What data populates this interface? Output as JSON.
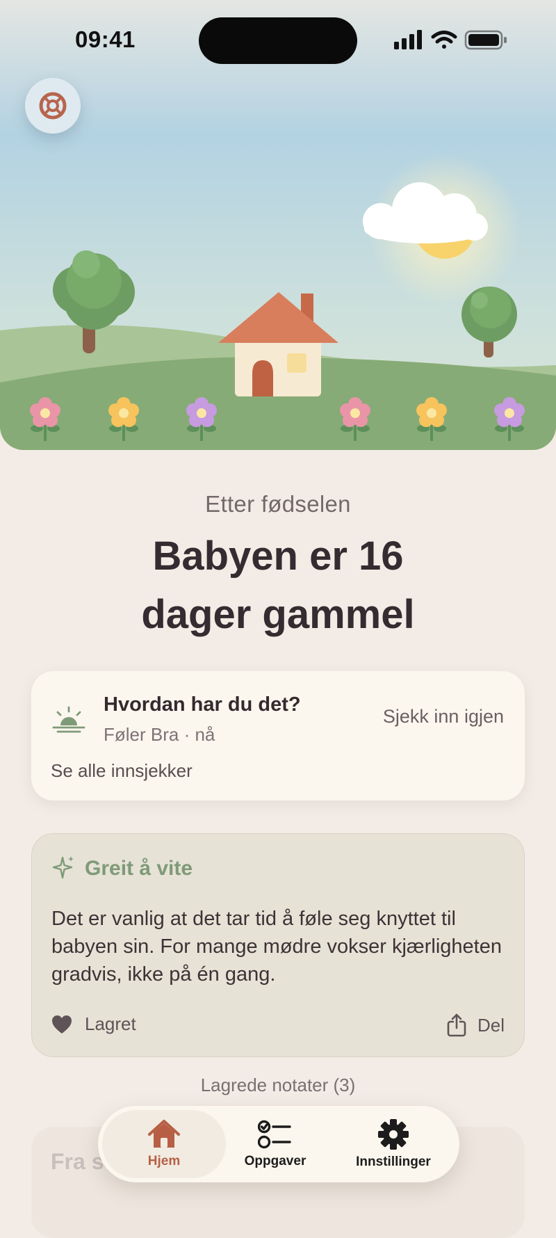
{
  "status_bar": {
    "time": "09:41"
  },
  "hero": {
    "help_icon": "lifebuoy-icon"
  },
  "header": {
    "subtitle": "Etter fødselen",
    "title_line1": "Babyen er 16",
    "title_line2": "dager gammel"
  },
  "checkin": {
    "icon": "sunrise-icon",
    "title": "Hvordan har du det?",
    "status": "Føler Bra · nå",
    "action": "Sjekk inn igjen",
    "see_all": "Se alle innsjekker"
  },
  "tip": {
    "icon": "sparkle-icon",
    "title": "Greit å vite",
    "body": "Det er vanlig at det tar tid å føle seg knyttet til babyen sin. For mange mødre vokser kjærligheten gradvis, ikke på én gang.",
    "save_label": "Lagret",
    "share_label": "Del"
  },
  "notes": {
    "link": "Lagrede notater (3)"
  },
  "faded_card": {
    "text": "Fra s"
  },
  "tabbar": {
    "tabs": [
      {
        "label": "Hjem",
        "icon": "home-icon",
        "active": true
      },
      {
        "label": "Oppgaver",
        "icon": "checklist-icon",
        "active": false
      },
      {
        "label": "Innstillinger",
        "icon": "gear-icon",
        "active": false
      }
    ]
  },
  "colors": {
    "accent": "#b75f45",
    "sage": "#7f9a78",
    "background": "#f3ece6",
    "card": "#fbf7ef"
  }
}
